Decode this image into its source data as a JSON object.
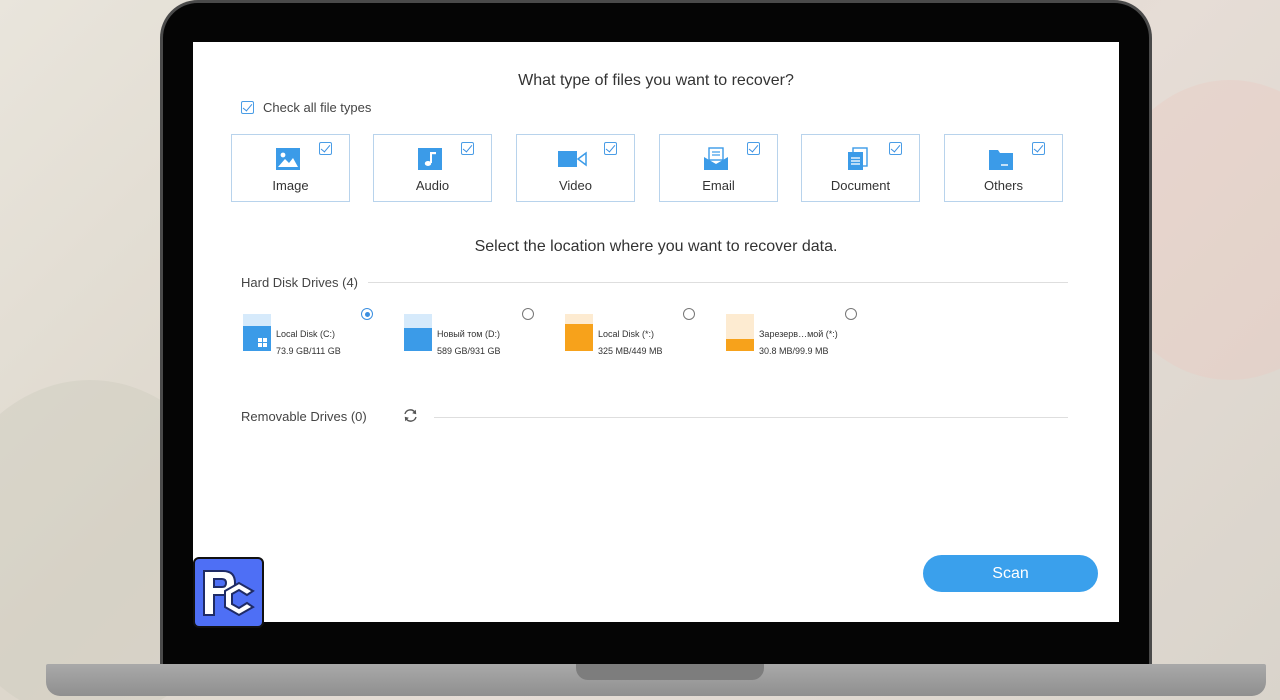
{
  "header": {
    "file_types_prompt": "What type of files you want to recover?",
    "check_all_label": "Check all file types",
    "location_prompt": "Select the location where you want to recover data."
  },
  "file_types": [
    {
      "label": "Image",
      "icon": "image-icon",
      "checked": true
    },
    {
      "label": "Audio",
      "icon": "music-note-icon",
      "checked": true
    },
    {
      "label": "Video",
      "icon": "video-camera-icon",
      "checked": true
    },
    {
      "label": "Email",
      "icon": "envelope-icon",
      "checked": true
    },
    {
      "label": "Document",
      "icon": "document-icon",
      "checked": true
    },
    {
      "label": "Others",
      "icon": "folder-icon",
      "checked": true
    }
  ],
  "hard_disks": {
    "label": "Hard Disk Drives (4)",
    "drives": [
      {
        "name": "Local Disk (C:)",
        "size": "73.9 GB/111 GB",
        "selected": true,
        "color": "#3b9be8",
        "used_fraction": 0.67
      },
      {
        "name": "Новый том (D:)",
        "size": "589 GB/931 GB",
        "selected": false,
        "color": "#3b9be8",
        "used_fraction": 0.63
      },
      {
        "name": "Local Disk (*:)",
        "size": "325 MB/449 MB",
        "selected": false,
        "color": "#f7a21b",
        "used_fraction": 0.72
      },
      {
        "name": "Зарезерв…мой (*:)",
        "size": "30.8 MB/99.9 MB",
        "selected": false,
        "color": "#f7a21b",
        "used_fraction": 0.31
      }
    ]
  },
  "removable": {
    "label": "Removable Drives (0)",
    "refresh_icon": "refresh-icon"
  },
  "actions": {
    "scan_label": "Scan"
  },
  "colors": {
    "accent": "#3aa0ec",
    "card_border": "#b8d3ec",
    "drive_blue": "#3b9be8",
    "drive_orange": "#f7a21b",
    "logo_bg": "#4e6ff5"
  },
  "branding": {
    "logo": "app-logo-icon"
  }
}
